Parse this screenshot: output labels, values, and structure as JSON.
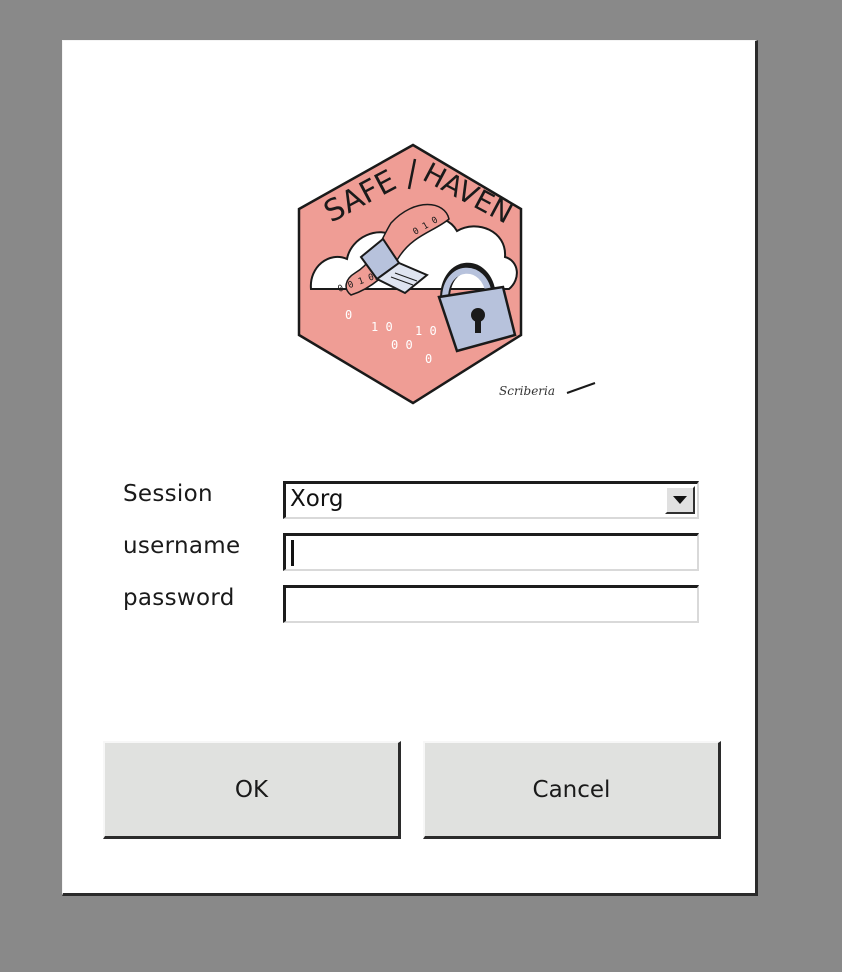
{
  "logo": {
    "text_left": "SAFE",
    "text_right": "HAVEN",
    "signature": "Scriberia",
    "colors": {
      "hexagon": "#ef9d95",
      "lock": "#b7c2dc",
      "outline": "#1a1a1a"
    }
  },
  "form": {
    "session_label": "Session",
    "session_value": "Xorg",
    "username_label": "username",
    "username_value": "",
    "password_label": "password",
    "password_value": ""
  },
  "buttons": {
    "ok_label": "OK",
    "cancel_label": "Cancel"
  },
  "colors": {
    "background": "#898989",
    "dialog": "#ffffff",
    "button": "#e0e1df"
  }
}
